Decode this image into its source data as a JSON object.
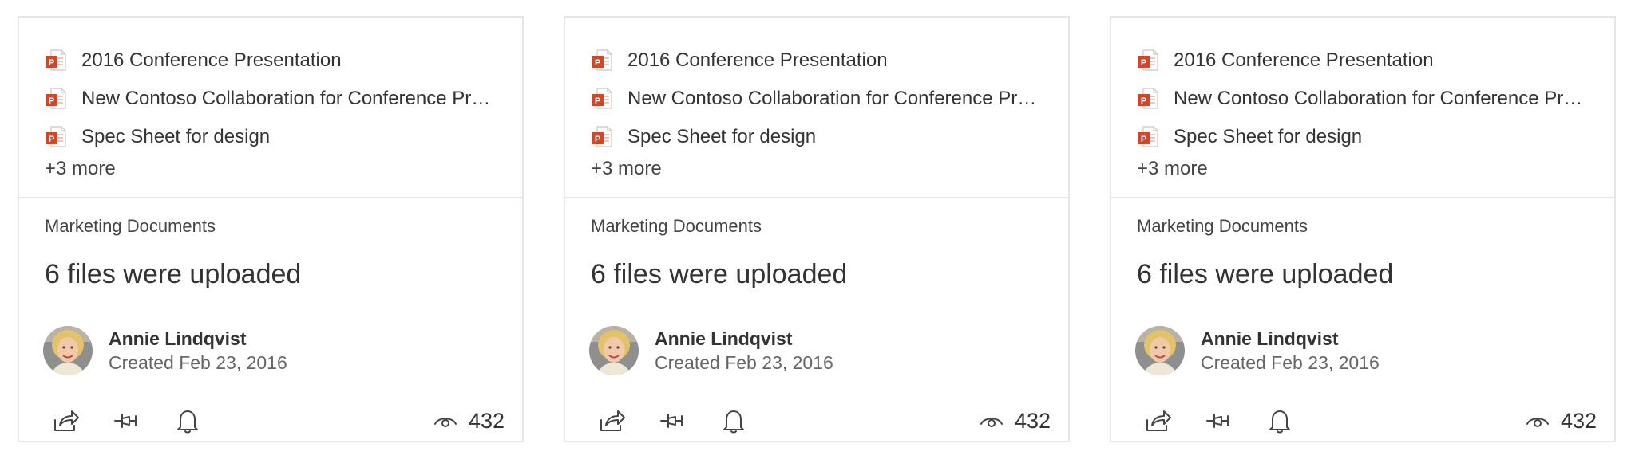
{
  "cards": [
    {
      "files": [
        {
          "name": "2016 Conference Presentation",
          "icon": "powerpoint-icon"
        },
        {
          "name": "New Contoso Collaboration for Conference Pre...",
          "icon": "powerpoint-icon"
        },
        {
          "name": "Spec Sheet for design",
          "icon": "powerpoint-icon"
        }
      ],
      "more": "+3 more",
      "library": "Marketing Documents",
      "headline": "6 files were uploaded",
      "author": {
        "name": "Annie Lindqvist",
        "date": "Created Feb 23, 2016"
      },
      "views": "432"
    },
    {
      "files": [
        {
          "name": "2016 Conference Presentation",
          "icon": "powerpoint-icon"
        },
        {
          "name": "New Contoso Collaboration for Conference Pre...",
          "icon": "powerpoint-icon"
        },
        {
          "name": "Spec Sheet for design",
          "icon": "powerpoint-icon"
        }
      ],
      "more": "+3 more",
      "library": "Marketing Documents",
      "headline": "6 files were uploaded",
      "author": {
        "name": "Annie Lindqvist",
        "date": "Created Feb 23, 2016"
      },
      "views": "432"
    },
    {
      "files": [
        {
          "name": "2016 Conference Presentation",
          "icon": "powerpoint-icon"
        },
        {
          "name": "New Contoso Collaboration for Conference Pre...",
          "icon": "powerpoint-icon"
        },
        {
          "name": "Spec Sheet for design",
          "icon": "powerpoint-icon"
        }
      ],
      "more": "+3 more",
      "library": "Marketing Documents",
      "headline": "6 files were uploaded",
      "author": {
        "name": "Annie Lindqvist",
        "date": "Created Feb 23, 2016"
      },
      "views": "432"
    }
  ],
  "icons": {
    "file": "powerpoint-icon",
    "actions": [
      "share-icon",
      "pin-icon",
      "bell-icon"
    ],
    "views": "eye-icon"
  },
  "colors": {
    "powerpoint": "#d24726",
    "border": "#e6e6e6",
    "text": "#333333",
    "secondary_text": "#666666"
  }
}
